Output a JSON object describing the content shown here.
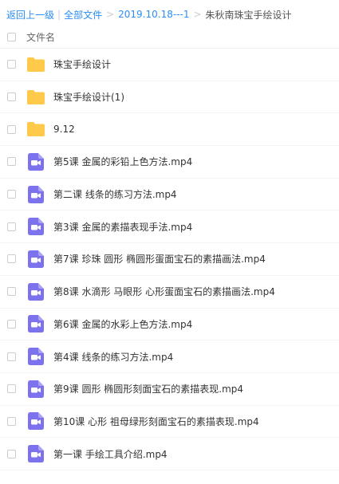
{
  "breadcrumb": {
    "back": "返回上一级",
    "all_files": "全部文件",
    "folder": "2019.10.18---1",
    "current": "朱秋南珠宝手绘设计"
  },
  "header": {
    "column_name": "文件名"
  },
  "colors": {
    "link": "#2b8df5",
    "folder": "#ffc94a",
    "video": "#7c72ee"
  },
  "files": [
    {
      "name": "珠宝手绘设计",
      "icon": "folder-icon"
    },
    {
      "name": "珠宝手绘设计(1)",
      "icon": "folder-icon"
    },
    {
      "name": "9.12",
      "icon": "folder-icon"
    },
    {
      "name": "第5课 金属的彩铅上色方法.mp4",
      "icon": "video-file-icon"
    },
    {
      "name": "第二课 线条的练习方法.mp4",
      "icon": "video-file-icon"
    },
    {
      "name": "第3课 金属的素描表现手法.mp4",
      "icon": "video-file-icon"
    },
    {
      "name": "第7课 珍珠 圆形 椭圆形蛋面宝石的素描画法.mp4",
      "icon": "video-file-icon"
    },
    {
      "name": "第8课 水滴形 马眼形 心形蛋面宝石的素描画法.mp4",
      "icon": "video-file-icon"
    },
    {
      "name": "第6课 金属的水彩上色方法.mp4",
      "icon": "video-file-icon"
    },
    {
      "name": "第4课 线条的练习方法.mp4",
      "icon": "video-file-icon"
    },
    {
      "name": "第9课 圆形 椭圆形刻面宝石的素描表现.mp4",
      "icon": "video-file-icon"
    },
    {
      "name": "第10课 心形 祖母绿形刻面宝石的素描表现.mp4",
      "icon": "video-file-icon"
    },
    {
      "name": "第一课 手绘工具介绍.mp4",
      "icon": "video-file-icon"
    }
  ]
}
